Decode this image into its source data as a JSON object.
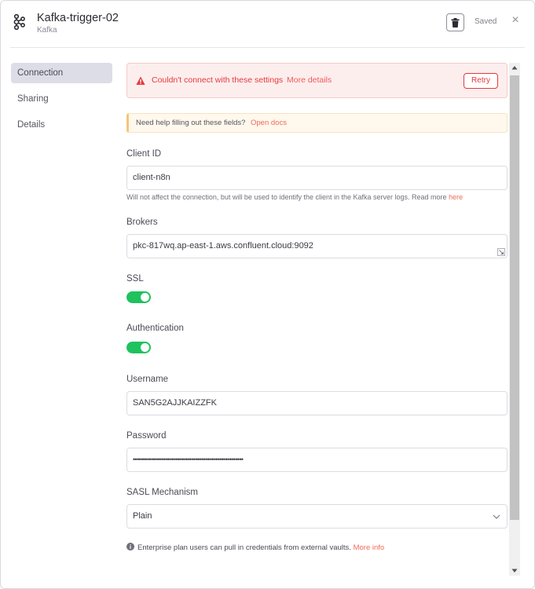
{
  "header": {
    "title": "Kafka-trigger-02",
    "subtitle": "Kafka",
    "status": "Saved",
    "close_glyph": "×",
    "app_icon": "kafka-logo-icon",
    "delete_icon": "trash-icon"
  },
  "sidebar": {
    "items": [
      {
        "label": "Connection",
        "active": true
      },
      {
        "label": "Sharing",
        "active": false
      },
      {
        "label": "Details",
        "active": false
      }
    ]
  },
  "error_banner": {
    "message": "Couldn't connect with these settings",
    "link": "More details",
    "retry_label": "Retry",
    "icon": "warning-icon"
  },
  "help_banner": {
    "text": "Need help filling out these fields?",
    "link": "Open docs"
  },
  "fields": {
    "client_id": {
      "label": "Client ID",
      "value": "client-n8n",
      "hint": "Will not affect the connection, but will be used to identify the client in the Kafka server logs. Read more ",
      "hint_link": "here"
    },
    "brokers": {
      "label": "Brokers",
      "value": "pkc-817wq.ap-east-1.aws.confluent.cloud:9092"
    },
    "ssl": {
      "label": "SSL",
      "enabled": true
    },
    "authentication": {
      "label": "Authentication",
      "enabled": true
    },
    "username": {
      "label": "Username",
      "value": "SAN5G2AJJKAIZZFK"
    },
    "password": {
      "label": "Password",
      "value": "•••••••••••••••••••••••••••••••••••••••••••••••••••••••"
    },
    "sasl": {
      "label": "SASL Mechanism",
      "value": "Plain"
    }
  },
  "footer": {
    "text": "Enterprise plan users can pull in credentials from external vaults.",
    "link": "More info"
  },
  "colors": {
    "accent": "#ef6a5a",
    "error": "#e5393d",
    "toggle_on": "#1fc25e"
  }
}
